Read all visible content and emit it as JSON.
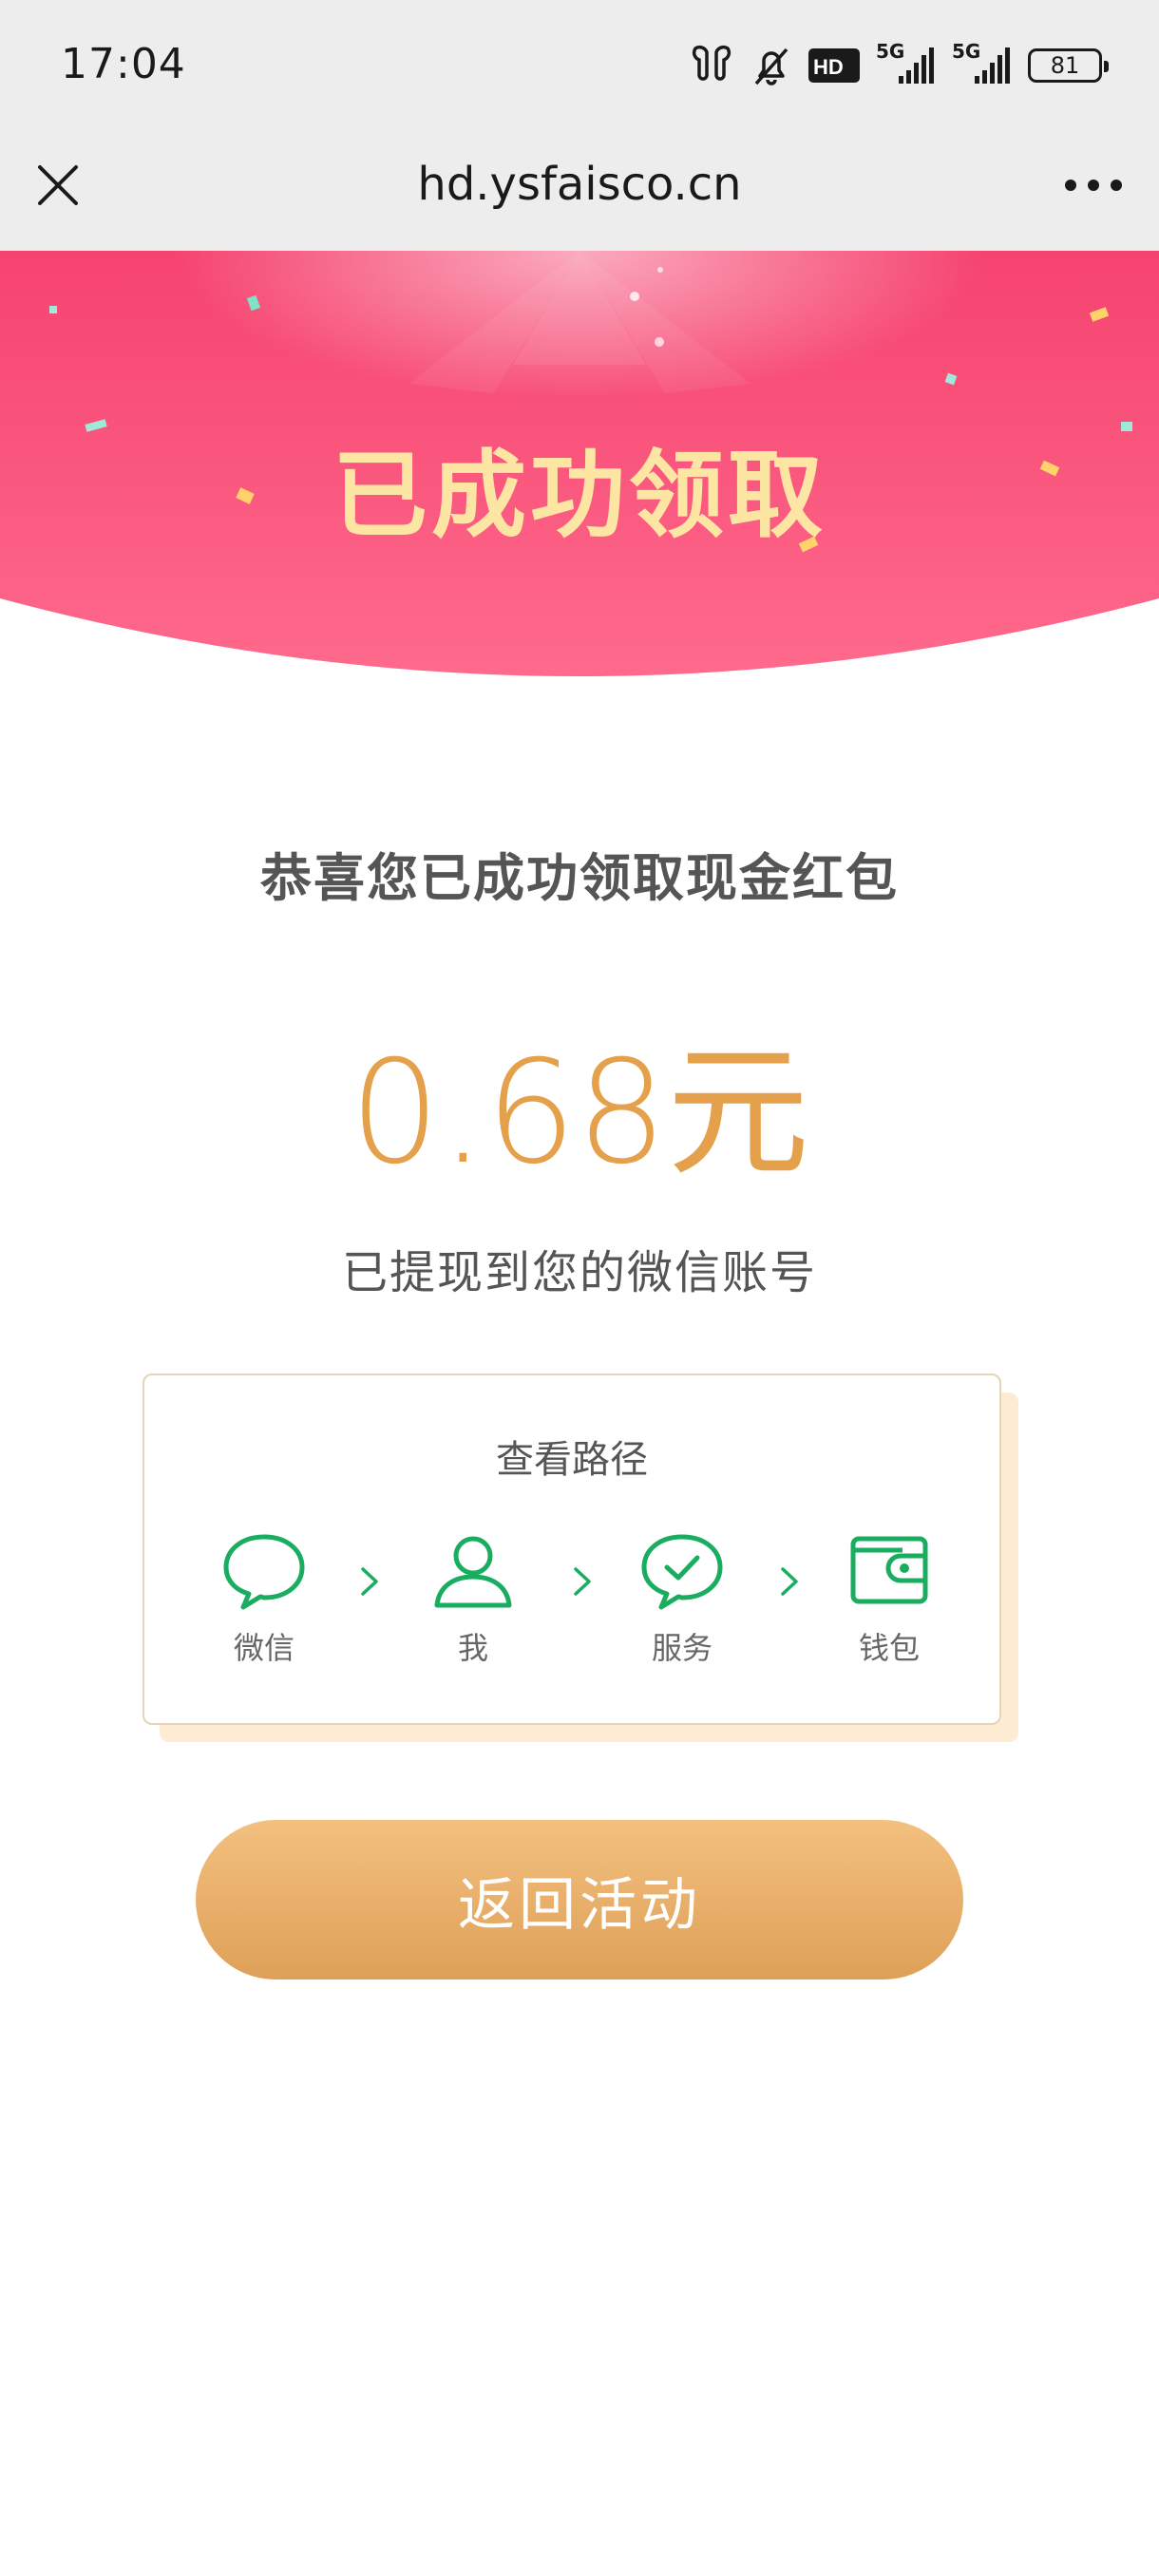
{
  "status_bar": {
    "time": "17:04",
    "network_1": "5G",
    "network_2": "5G",
    "hd_badge": "HD",
    "battery": "81",
    "icons": [
      "earbuds-icon",
      "bell-muted-icon",
      "hd-icon",
      "signal-icon",
      "signal-icon",
      "battery-icon"
    ]
  },
  "browser": {
    "url": "hd.ysfaisco.cn",
    "close_icon": "close-icon",
    "more_icon": "more-icon"
  },
  "banner": {
    "title": "已成功领取",
    "bg_top": "#f5436f",
    "bg_bottom": "#ff6a8c"
  },
  "main": {
    "congrats": "恭喜您已成功领取现金红包",
    "amount": "0.68元",
    "withdraw_note": "已提现到您的微信账号"
  },
  "path_card": {
    "title": "查看路径",
    "steps": [
      {
        "label": "微信",
        "icon": "chat-icon"
      },
      {
        "label": "我",
        "icon": "person-icon"
      },
      {
        "label": "服务",
        "icon": "service-check-icon"
      },
      {
        "label": "钱包",
        "icon": "wallet-icon"
      }
    ],
    "icon_color": "#1aad5f"
  },
  "action": {
    "return_label": "返回活动",
    "accent": "#e8ad66"
  }
}
